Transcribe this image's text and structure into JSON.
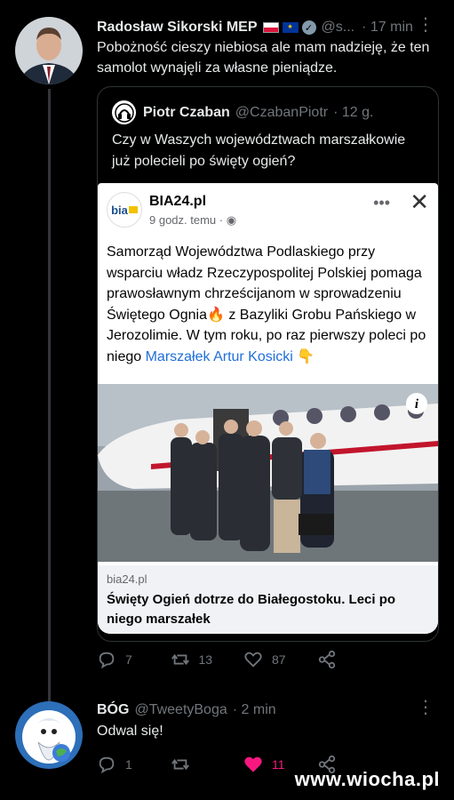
{
  "tweet1": {
    "name": "Radosław Sikorski MEP",
    "flags": [
      "PL-flag",
      "EU-flag"
    ],
    "verified_icon": "verified-badge-icon",
    "handle": "@s...",
    "time": "· 17 min",
    "text": "Pobożność cieszy niebiosa ale mam nadzieję, że ten samolot wynajęli za własne pieniądze.",
    "quote": {
      "name": "Piotr Czaban",
      "handle": "@CzabanPiotr",
      "time": "· 12 g.",
      "text": "Czy w Waszych województwach marszałkowie już polecieli po święty ogień?",
      "fb": {
        "logo_text": "bia",
        "page": "BIA24.pl",
        "time": "9 godz. temu ·",
        "text_before_link": "Samorząd Województwa Podlaskiego przy wsparciu władz Rzeczypospolitej Polskiej pomaga prawosławnym chrześcijanom w sprowadzeniu Świętego Ognia🔥 z Bazyliki Grobu Pańskiego w Jerozolimie. W tym roku, po raz pierwszy poleci po niego ",
        "link_text": "Marszałek Artur Kosicki",
        "emoji_after": " 👇",
        "domain": "bia24.pl",
        "headline": "Święty Ogień dotrze do Białegostoku. Leci po niego marszałek"
      }
    },
    "actions": {
      "replies": "7",
      "retweets": "13",
      "likes": "87"
    }
  },
  "tweet2": {
    "name": "BÓG",
    "handle": "@TweetyBoga",
    "time": "· 2 min",
    "text": "Odwal się!",
    "actions": {
      "replies": "1",
      "retweets": "",
      "likes": "11"
    }
  },
  "watermark": "www.wiocha.pl",
  "colors": {
    "background": "#000000",
    "text": "#e7e9ea",
    "muted": "#71767b",
    "like_pink": "#f91880",
    "link_blue": "#216fdb"
  }
}
